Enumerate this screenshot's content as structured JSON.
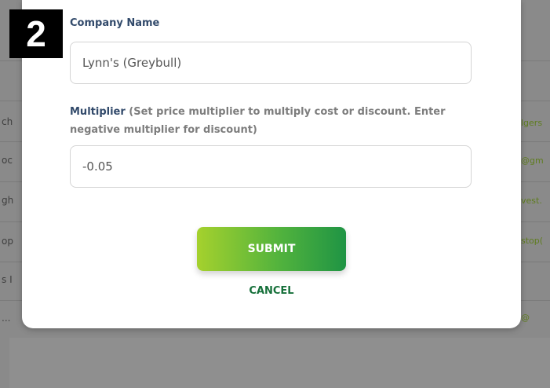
{
  "step_badge": "2",
  "background_rows": {
    "left_fragments": [
      "ch",
      "oc",
      "gh",
      "op",
      "s I",
      "..."
    ],
    "right_fragments": [
      "lgers",
      "@gm",
      "vest.",
      "stop(",
      "",
      "@"
    ]
  },
  "form": {
    "company_name_label": "Company Name",
    "company_name_value": "Lynn's (Greybull)",
    "multiplier_label": "Multiplier",
    "multiplier_hint": "(Set price multiplier to multiply cost or discount. Enter negative multiplier for discount)",
    "multiplier_value": "-0.05",
    "submit_label": "SUBMIT",
    "cancel_label": "CANCEL"
  },
  "colors": {
    "label_blue": "#324a6b",
    "submit_gradient_start": "#a5d12d",
    "submit_gradient_end": "#1f9444",
    "cancel_green": "#16703a",
    "overlay_gray": "#8a8a8a"
  }
}
